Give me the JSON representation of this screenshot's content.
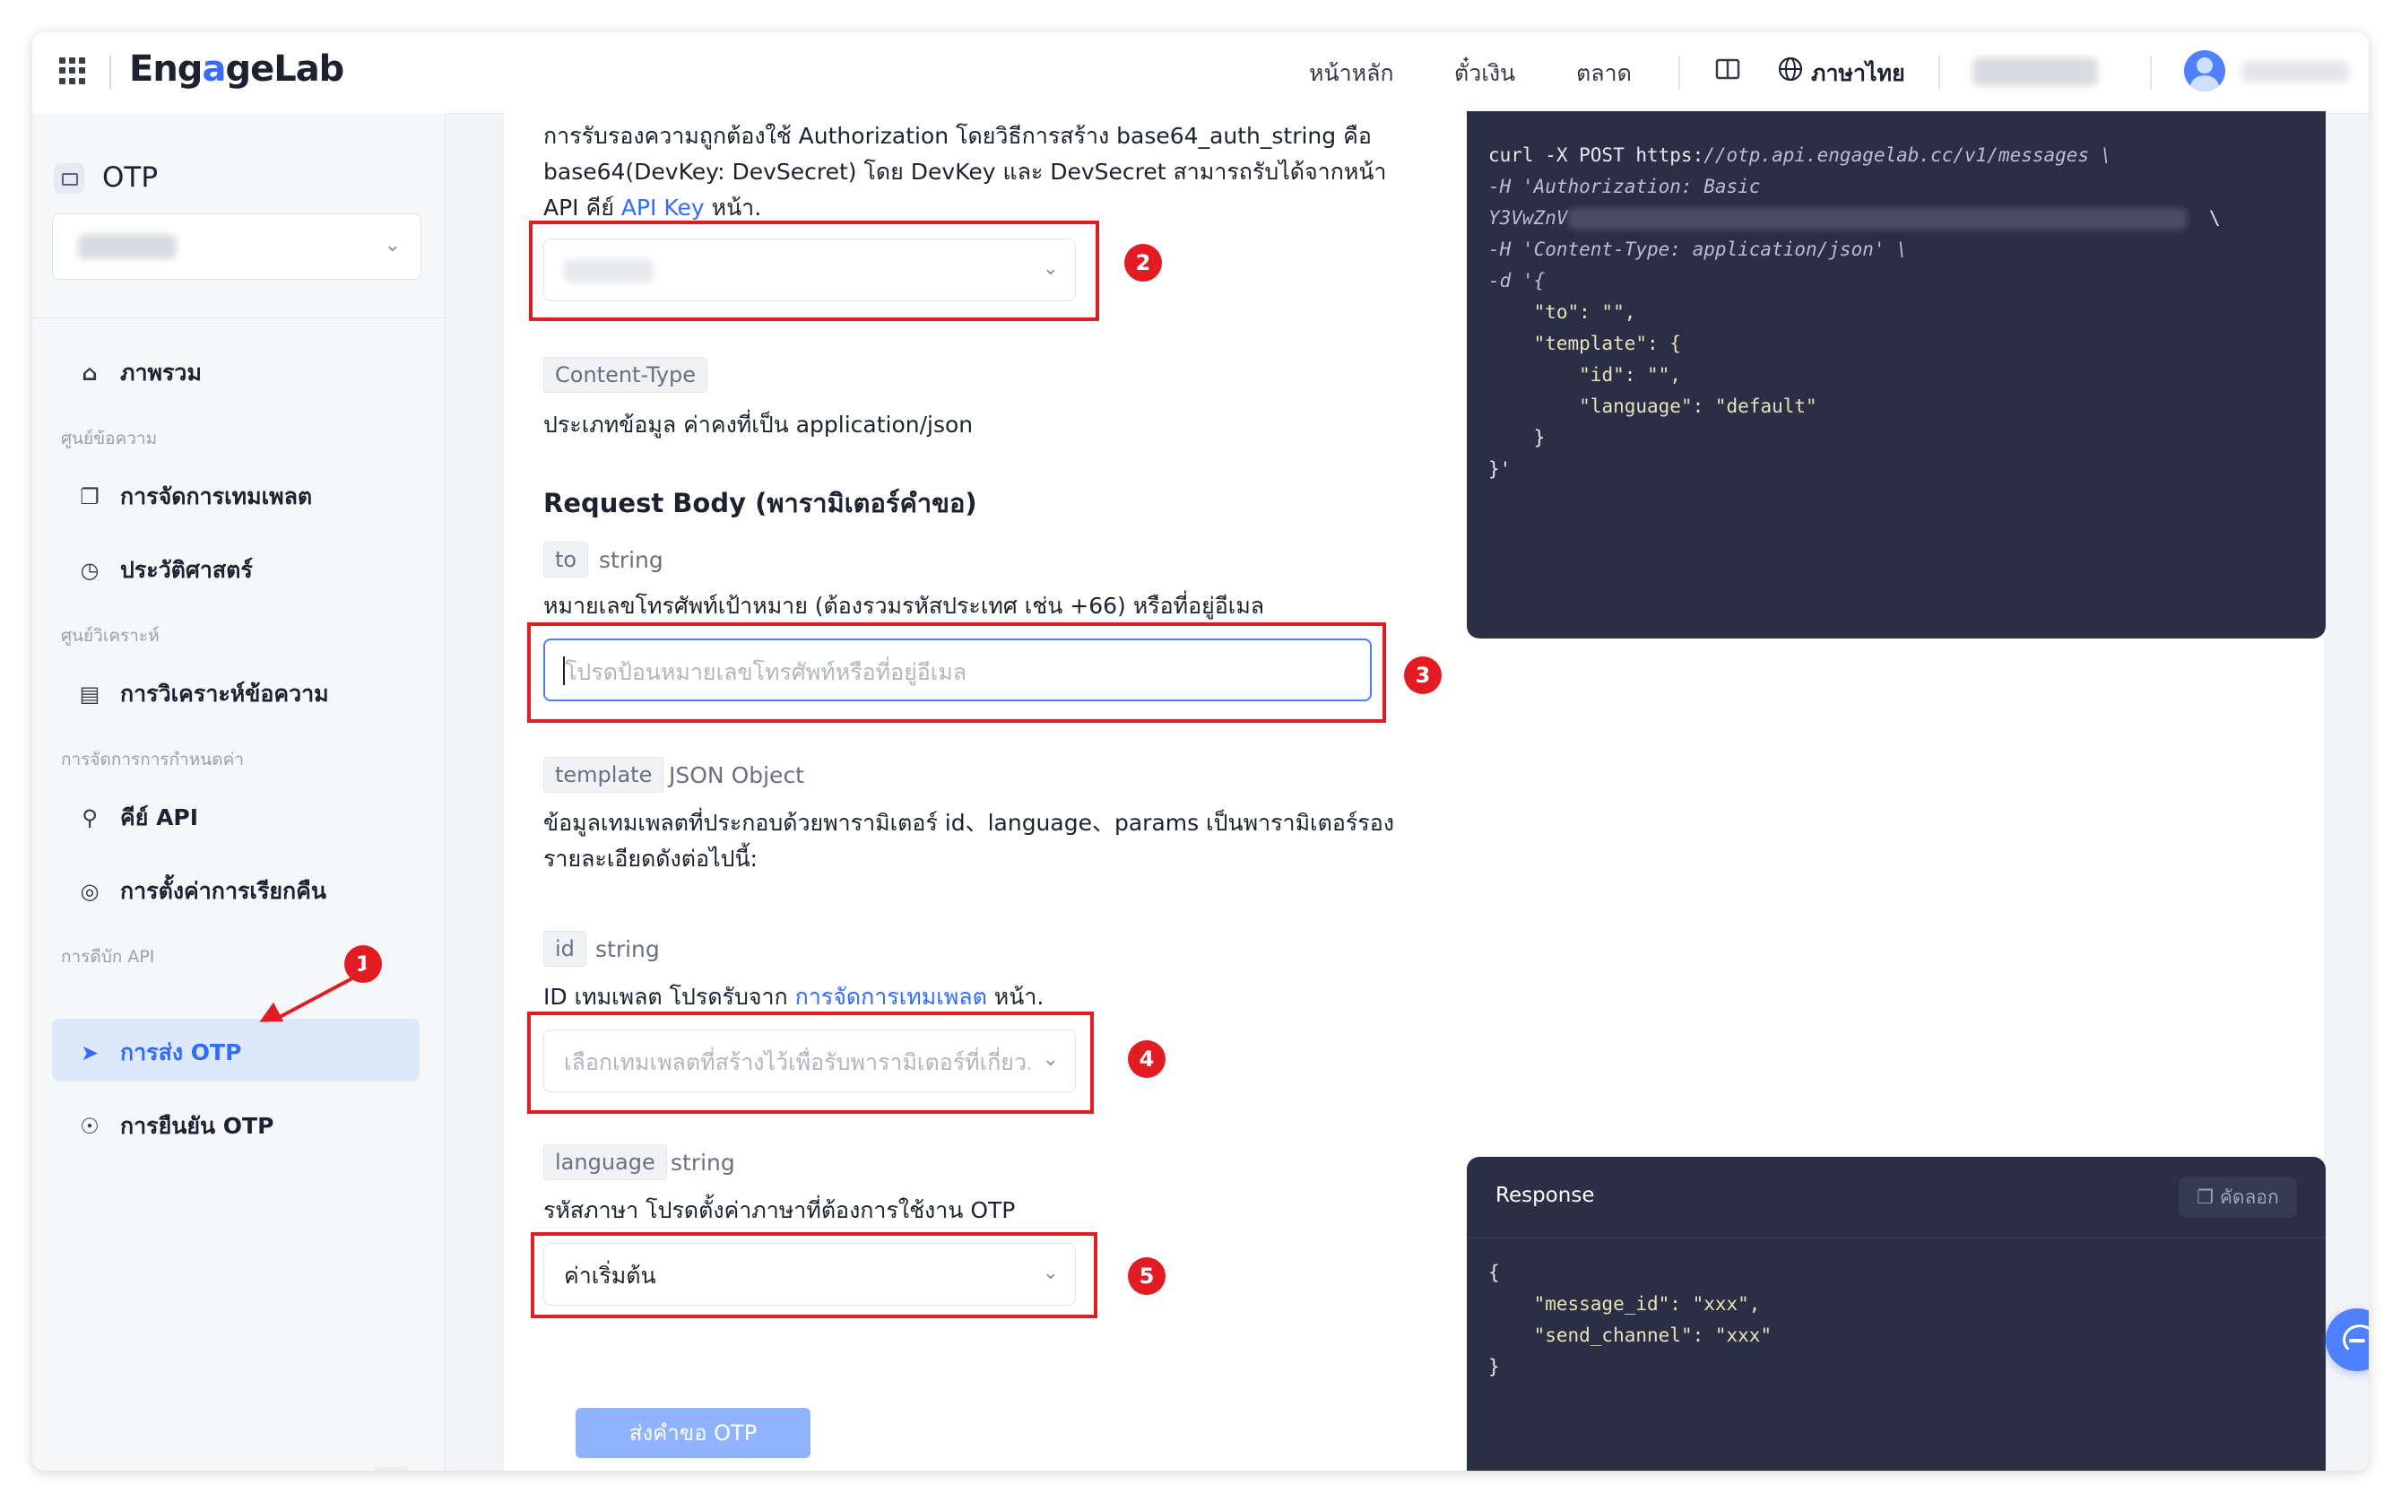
{
  "topbar": {
    "brand": {
      "part1": "Eng",
      "part2": "a",
      "part3": "geLab"
    },
    "nav": [
      "หน้าหลัก",
      "ตั๋วเงิน",
      "ตลาด"
    ],
    "language": "ภาษาไทย"
  },
  "sidebar": {
    "product": "OTP",
    "items": [
      {
        "label": "ภาพรวม",
        "icon": "home-icon"
      },
      {
        "group": "ศูนย์ข้อความ"
      },
      {
        "label": "การจัดการเทมเพลต",
        "icon": "copy-icon"
      },
      {
        "label": "ประวัติศาสตร์",
        "icon": "history-icon"
      },
      {
        "group": "ศูนย์วิเคราะห์"
      },
      {
        "label": "การวิเคราะห์ข้อความ",
        "icon": "message-icon"
      },
      {
        "group": "การจัดการการกำหนดค่า"
      },
      {
        "label": "คีย์ API",
        "icon": "lock-icon"
      },
      {
        "label": "การตั้งค่าการเรียกคืน",
        "icon": "settings-icon"
      },
      {
        "group": "การดีบัก API"
      },
      {
        "label": "การส่ง OTP",
        "icon": "send-icon",
        "active": true
      },
      {
        "label": "การยืนยัน OTP",
        "icon": "shield-icon"
      }
    ]
  },
  "main": {
    "auth_desc_line1": "การรับรองความถูกต้องใช้ Authorization โดยวิธีการสร้าง base64_auth_string คือ",
    "auth_desc_line2": "base64(DevKey: DevSecret) โดย DevKey และ DevSecret สามารถรับได้จากหน้า",
    "auth_desc_line3_a": "API คีย์",
    "auth_desc_line3_link": "API Key",
    "auth_desc_line3_b": "หน้า.",
    "content_type_tag": "Content-Type",
    "content_type_desc": "ประเภทข้อมูล ค่าคงที่เป็น application/json",
    "request_body_heading": "Request Body (พารามิเตอร์คำขอ)",
    "to_tag": "to",
    "to_type": "string",
    "to_desc": "หมายเลขโทรศัพท์เป้าหมาย (ต้องรวมรหัสประเทศ เช่น +66) หรือที่อยู่อีเมล",
    "to_placeholder": "โปรดป้อนหมายเลขโทรศัพท์หรือที่อยู่อีเมล",
    "template_tag": "template",
    "template_type": "JSON Object",
    "template_desc_line1": "ข้อมูลเทมเพลตที่ประกอบด้วยพารามิเตอร์ id、language、params เป็นพารามิเตอร์รอง",
    "template_desc_line2": "รายละเอียดดังต่อไปนี้:",
    "id_tag": "id",
    "id_type": "string",
    "id_desc_a": "ID เทมเพลต โปรดรับจาก",
    "id_desc_link": "การจัดการเทมเพลต",
    "id_desc_b": "หน้า.",
    "id_placeholder": "เลือกเทมเพลตที่สร้างไว้เพื่อรับพารามิเตอร์ที่เกี่ยว...",
    "language_tag": "language",
    "language_type": "string",
    "language_desc": "รหัสภาษา โปรดตั้งค่าภาษาที่ต้องการใช้งาน OTP",
    "language_value": "ค่าเริ่มต้น",
    "submit_label": "ส่งคำขอ OTP"
  },
  "request_code": {
    "line1_cmd": "curl -X POST https:",
    "line1_url": "//otp.api.engagelab.cc/v1/messages \\",
    "line2": "-H 'Authorization: Basic",
    "line3": "Y3VwZnV",
    "line3_end": "\\",
    "line4": "-H 'Content-Type: application/json' \\",
    "line5": "-d '{",
    "line6": "\"to\": \"\",",
    "line7": "\"template\": {",
    "line8": "\"id\": \"\",",
    "line9_key": "\"language\":",
    "line9_val": "\"default\"",
    "line10": "}",
    "line11": "}'"
  },
  "response": {
    "title": "Response",
    "copy_label": "คัดลอก",
    "line1": "{",
    "line2": "\"message_id\": \"xxx\",",
    "line3": "\"send_channel\": \"xxx\"",
    "line4": "}"
  },
  "annotations": [
    "1",
    "2",
    "3",
    "4",
    "5"
  ],
  "colors": {
    "accent": "#2f6cff",
    "annotation_red": "#e31b23",
    "code_bg": "#2b2f45"
  }
}
